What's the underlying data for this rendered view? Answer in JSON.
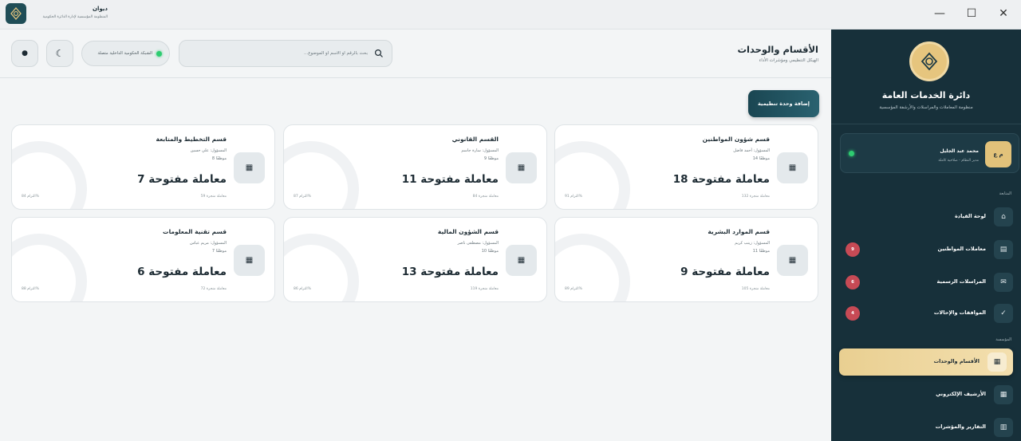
{
  "app": {
    "title": "ديوان",
    "subtitle": "المنظومة المؤسسية لإدارة الدائرة الحكومية"
  },
  "window_controls": {
    "minimize": "—",
    "maximize": "☐",
    "close": "✕"
  },
  "header": {
    "title": "الأقسام والوحدات",
    "subtitle": "الهيكل التنظيمي ومؤشرات الأداء",
    "search_placeholder": "بحث بالرقم أو الاسم أو الموضوع...",
    "network_status": "الشبكة الحكومية الداخلية متصلة",
    "theme_icon": "☾",
    "dot_icon": "●"
  },
  "actions": {
    "add_unit": "إضافة وحدة تنظيمية"
  },
  "sidebar": {
    "org_title": "دائرة الخدمات العامة",
    "org_subtitle": "منظومة المعاملات والمراسلات والأرشفة المؤسسية",
    "user": {
      "initials": "م ع",
      "name": "محمد عبد الجليل",
      "role": "مدير النظام - صلاحية كاملة"
    },
    "sections": {
      "follow_up": "المتابعة",
      "institution": "المؤسسة"
    },
    "items": [
      {
        "label": "لوحة القيادة",
        "icon": "⌂",
        "badge": ""
      },
      {
        "label": "معاملات المواطنين",
        "icon": "▤",
        "badge": "9"
      },
      {
        "label": "المراسلات الرسمية",
        "icon": "✉",
        "badge": "6"
      },
      {
        "label": "الموافقات والإحالات",
        "icon": "✓",
        "badge": "4"
      },
      {
        "label": "الأقسام والوحدات",
        "icon": "▦",
        "badge": ""
      },
      {
        "label": "الأرشيف الإلكتروني",
        "icon": "▦",
        "badge": ""
      },
      {
        "label": "التقارير والمؤشرات",
        "icon": "▥",
        "badge": ""
      }
    ]
  },
  "departments": [
    {
      "name": "قسم شؤون المواطنين",
      "manager": "المسؤول: أحمد فاضل",
      "employees": "14 موظفًا",
      "open": "18 معاملة مفتوحة",
      "completed": "132 معاملة منجزة",
      "commitment": "التزام 91%"
    },
    {
      "name": "القسم القانوني",
      "manager": "المسؤول: سارة جاسم",
      "employees": "9 موظفًا",
      "open": "11 معاملة مفتوحة",
      "completed": "84 معاملة منجزة",
      "commitment": "التزام 87%"
    },
    {
      "name": "قسم التخطيط والمتابعة",
      "manager": "المسؤول: علي حسين",
      "employees": "8 موظفًا",
      "open": "7 معاملة مفتوحة",
      "completed": "59 معاملة منجزة",
      "commitment": "التزام 84%"
    },
    {
      "name": "قسم الموارد البشرية",
      "manager": "المسؤول: زينب كريم",
      "employees": "11 موظفًا",
      "open": "9 معاملة مفتوحة",
      "completed": "105 معاملة منجزة",
      "commitment": "التزام 89%"
    },
    {
      "name": "قسم الشؤون المالية",
      "manager": "المسؤول: مصطفى ناصر",
      "employees": "10 موظفًا",
      "open": "13 معاملة مفتوحة",
      "completed": "119 معاملة منجزة",
      "commitment": "التزام 86%"
    },
    {
      "name": "قسم تقنية المعلومات",
      "manager": "المسؤول: مريم عباس",
      "employees": "7 موظفًا",
      "open": "6 معاملة مفتوحة",
      "completed": "72 معاملة منجزة",
      "commitment": "التزام 88%"
    }
  ]
}
